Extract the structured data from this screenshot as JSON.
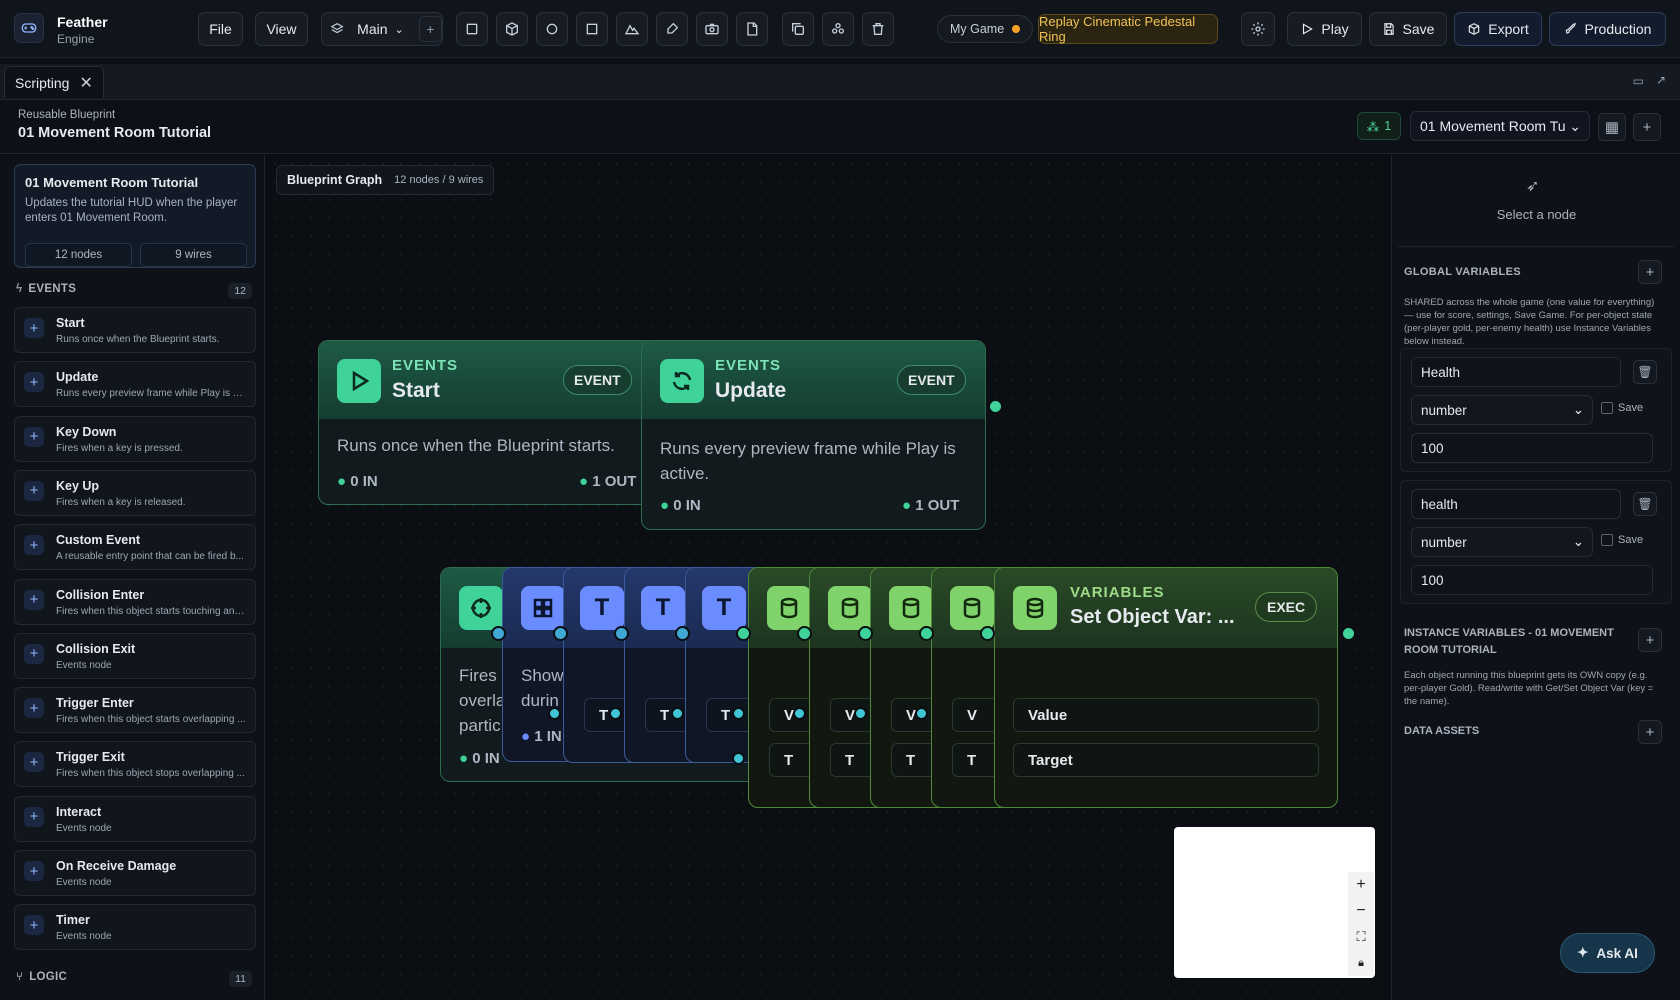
{
  "app": {
    "name": "Feather",
    "sub": "Engine"
  },
  "menu": {
    "file": "File",
    "view": "View",
    "scene": "Main"
  },
  "game": {
    "name": "My Game"
  },
  "replay": "Replay Cinematic Pedestal Ring",
  "actions": {
    "play": "Play",
    "save": "Save",
    "export": "Export",
    "production": "Production"
  },
  "tab": {
    "label": "Scripting"
  },
  "header": {
    "kind": "Reusable Blueprint",
    "title": "01 Movement Room Tutorial",
    "badge": "1",
    "select": "01 Movement Room Tu"
  },
  "card": {
    "title": "01 Movement Room Tutorial",
    "desc": "Updates the tutorial HUD when the player enters 01 Movement Room.",
    "nodes": "12 nodes",
    "wires": "9 wires"
  },
  "sections": {
    "events": "EVENTS",
    "events_count": "12",
    "logic": "LOGIC",
    "logic_count": "11"
  },
  "events": [
    {
      "name": "Start",
      "desc": "Runs once when the Blueprint starts."
    },
    {
      "name": "Update",
      "desc": "Runs every preview frame while Play is ac..."
    },
    {
      "name": "Key Down",
      "desc": "Fires when a key is pressed."
    },
    {
      "name": "Key Up",
      "desc": "Fires when a key is released."
    },
    {
      "name": "Custom Event",
      "desc": "A reusable entry point that can be fired b..."
    },
    {
      "name": "Collision Enter",
      "desc": "Fires when this object starts touching ano..."
    },
    {
      "name": "Collision Exit",
      "desc": "Events node"
    },
    {
      "name": "Trigger Enter",
      "desc": "Fires when this object starts overlapping ..."
    },
    {
      "name": "Trigger Exit",
      "desc": "Fires when this object stops overlapping ..."
    },
    {
      "name": "Interact",
      "desc": "Events node"
    },
    {
      "name": "On Receive Damage",
      "desc": "Events node"
    },
    {
      "name": "Timer",
      "desc": "Events node"
    }
  ],
  "graph": {
    "title": "Blueprint Graph",
    "meta": "12 nodes / 9 wires"
  },
  "nodes": {
    "start": {
      "cat": "EVENTS",
      "title": "Start",
      "badge": "EVENT",
      "desc": "Runs once when the Blueprint starts.",
      "in": "0 IN",
      "out": "1 OUT"
    },
    "update": {
      "cat": "EVENTS",
      "title": "Update",
      "badge": "EVENT",
      "desc": "Runs every preview frame while Play is active.",
      "in": "0 IN",
      "out": "1 OUT"
    },
    "setvar": {
      "cat": "VARIABLES",
      "title": "Set Object Var: ...",
      "badge": "EXEC",
      "value": "Value",
      "target": "Target"
    },
    "partial": {
      "fires": "Fires",
      "overla": "overla",
      "partic": "partic",
      "in0": "0 IN",
      "show": "Show",
      "durin": "durin",
      "in1": "1 IN",
      "t": "T",
      "v": "V"
    }
  },
  "inspector": {
    "select": "Select a node"
  },
  "globals": {
    "title": "GLOBAL VARIABLES",
    "desc": "SHARED across the whole game (one value for everything) — use for score, settings, Save Game. For per-object state (per-player gold, per-enemy health) use Instance Variables below instead.",
    "vars": [
      {
        "name": "Health",
        "type": "number",
        "save": "Save",
        "value": "100"
      },
      {
        "name": "health",
        "type": "number",
        "save": "Save",
        "value": "100"
      }
    ]
  },
  "instance": {
    "title": "INSTANCE VARIABLES - 01 MOVEMENT ROOM TUTORIAL",
    "desc": "Each object running this blueprint gets its OWN copy (e.g. per-player Gold). Read/write with Get/Set Object Var (key = the name)."
  },
  "assets": {
    "title": "DATA ASSETS"
  },
  "ask": "Ask AI"
}
